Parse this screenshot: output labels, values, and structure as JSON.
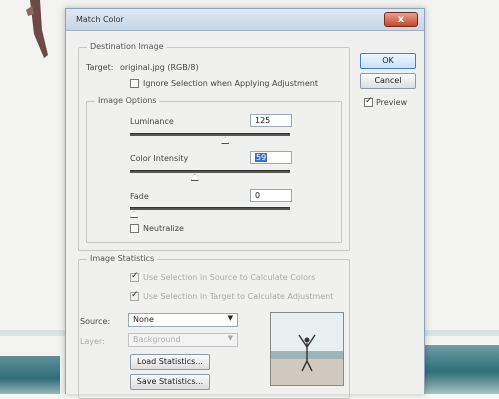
{
  "dialog": {
    "title": "Match Color",
    "close_label": "x"
  },
  "destination": {
    "legend": "Destination Image",
    "target_label": "Target:",
    "target_value": "original.jpg (RGB/8)",
    "ignore_selection_label": "Ignore Selection when Applying Adjustment"
  },
  "image_options": {
    "legend": "Image Options",
    "luminance_label": "Luminance",
    "luminance_value": "125",
    "color_intensity_label": "Color Intensity",
    "color_intensity_value": "59",
    "fade_label": "Fade",
    "fade_value": "0",
    "neutralize_label": "Neutralize",
    "luminance_slider": 0.6,
    "color_intensity_slider": 0.4,
    "fade_slider": 0.0
  },
  "image_statistics": {
    "legend": "Image Statistics",
    "use_source_label": "Use Selection in Source to Calculate Colors",
    "use_target_label": "Use Selection in Target to Calculate Adjustment",
    "source_label": "Source:",
    "source_value": "None",
    "layer_label": "Layer:",
    "layer_value": "Background",
    "load_stats_label": "Load Statistics...",
    "save_stats_label": "Save Statistics..."
  },
  "buttons": {
    "ok_label": "OK",
    "cancel_label": "Cancel",
    "preview_label": "Preview"
  },
  "colors": {
    "accent": "#3b6fc8",
    "close": "#c24a2e",
    "sea": "#2f6d78"
  }
}
